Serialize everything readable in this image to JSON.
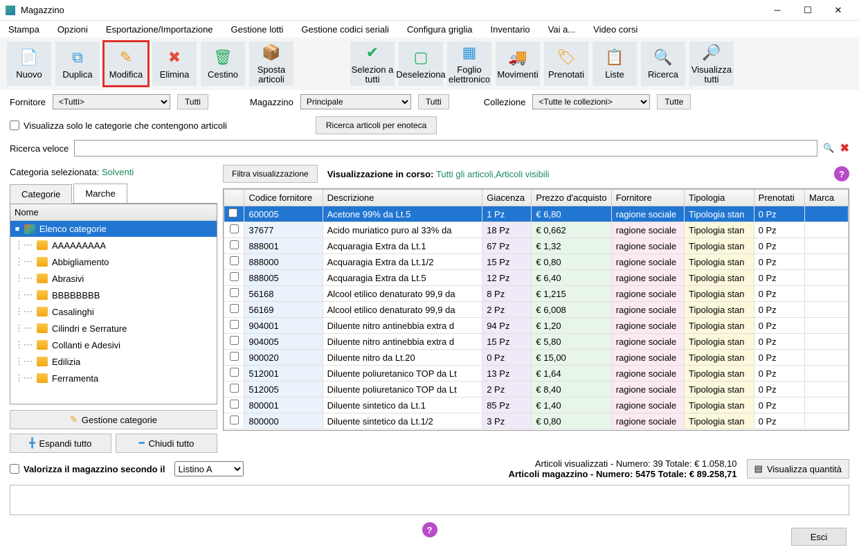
{
  "window": {
    "title": "Magazzino"
  },
  "menu": [
    "Stampa",
    "Opzioni",
    "Esportazione/Importazione",
    "Gestione lotti",
    "Gestione codici seriali",
    "Configura griglia",
    "Inventario",
    "Vai a...",
    "Video corsi"
  ],
  "toolbar": [
    {
      "id": "nuovo",
      "label": "Nuovo",
      "icon": "📄",
      "cls": "ic-orange"
    },
    {
      "id": "duplica",
      "label": "Duplica",
      "icon": "⧉",
      "cls": "ic-blue"
    },
    {
      "id": "modifica",
      "label": "Modifica",
      "icon": "✎",
      "cls": "ic-orange",
      "hl": true
    },
    {
      "id": "elimina",
      "label": "Elimina",
      "icon": "✖",
      "cls": "ic-red"
    },
    {
      "id": "cestino",
      "label": "Cestino",
      "icon": "🗑",
      "cls": "ic-green"
    },
    {
      "id": "sposta",
      "label": "Sposta articoli",
      "icon": "📦",
      "cls": "ic-orange"
    },
    {
      "id": "gap",
      "label": "",
      "icon": "",
      "gap": true
    },
    {
      "id": "seltutti",
      "label": "Selezion a tutti",
      "icon": "✔",
      "cls": "ic-green"
    },
    {
      "id": "desel",
      "label": "Deseleziona",
      "icon": "▢",
      "cls": "ic-green"
    },
    {
      "id": "foglio",
      "label": "Foglio elettronico",
      "icon": "▦",
      "cls": "ic-blue"
    },
    {
      "id": "movimenti",
      "label": "Movimenti",
      "icon": "🚚",
      "cls": "ic-blue"
    },
    {
      "id": "prenotati",
      "label": "Prenotati",
      "icon": "🏷",
      "cls": "ic-orange"
    },
    {
      "id": "liste",
      "label": "Liste",
      "icon": "📋",
      "cls": "ic-orange"
    },
    {
      "id": "ricerca",
      "label": "Ricerca",
      "icon": "🔍",
      "cls": "ic-blue"
    },
    {
      "id": "vistutti",
      "label": "Visualizza tutti",
      "icon": "🔎",
      "cls": "ic-blue"
    }
  ],
  "filters": {
    "fornitore_label": "Fornitore",
    "fornitore_value": "<Tutti>",
    "tutti": "Tutti",
    "magazzino_label": "Magazzino",
    "magazzino_value": "Principale",
    "collezione_label": "Collezione",
    "collezione_value": "<Tutte le collezioni>",
    "tutte": "Tutte",
    "showonly": "Visualizza solo le categorie che contengono articoli",
    "ricerca_enoteca": "Ricerca articoli per enoteca",
    "ricerca_veloce": "Ricerca veloce"
  },
  "left": {
    "header_prefix": "Categoria selezionata: ",
    "header_value": "Solventi",
    "tab_cat": "Categorie",
    "tab_marche": "Marche",
    "tree_header": "Nome",
    "root": "Elenco categorie",
    "items": [
      "AAAAAAAAA",
      "Abbigliamento",
      "Abrasivi",
      "BBBBBBBB",
      "Casalinghi",
      "Cilindri e Serrature",
      "Collanti e Adesivi",
      "Edilizia",
      "Ferramenta"
    ],
    "btn_gestione": "Gestione categorie",
    "btn_espandi": "Espandi tutto",
    "btn_chiudi": "Chiudi tutto"
  },
  "grid": {
    "filter_btn": "Filtra visualizzazione",
    "vis_prefix": "Visualizzazione in corso: ",
    "vis_value": "Tutti gli articoli,Articoli visibili",
    "headers": [
      "",
      "Codice fornitore",
      "Descrizione",
      "Giacenza",
      "Prezzo d'acquisto",
      "Fornitore",
      "Tipologia",
      "Prenotati",
      "Marca"
    ],
    "rows": [
      {
        "code": "600005",
        "desc": "Acetone 99% da Lt.5",
        "giac": "1 Pz",
        "prezzo": "€ 6,80",
        "forn": "ragione sociale",
        "tipo": "Tipologia stan",
        "pren": "0 Pz",
        "marca": "",
        "sel": true
      },
      {
        "code": "37677",
        "desc": "Acido muriatico puro al 33% da",
        "giac": "18 Pz",
        "prezzo": "€ 0,662",
        "forn": "ragione sociale",
        "tipo": "Tipologia stan",
        "pren": "0 Pz",
        "marca": ""
      },
      {
        "code": "888001",
        "desc": "Acquaragia Extra da Lt.1",
        "giac": "67 Pz",
        "prezzo": "€ 1,32",
        "forn": "ragione sociale",
        "tipo": "Tipologia stan",
        "pren": "0 Pz",
        "marca": ""
      },
      {
        "code": "888000",
        "desc": "Acquaragia Extra da Lt.1/2",
        "giac": "15 Pz",
        "prezzo": "€ 0,80",
        "forn": "ragione sociale",
        "tipo": "Tipologia stan",
        "pren": "0 Pz",
        "marca": ""
      },
      {
        "code": "888005",
        "desc": "Acquaragia Extra da Lt.5",
        "giac": "12 Pz",
        "prezzo": "€ 6,40",
        "forn": "ragione sociale",
        "tipo": "Tipologia stan",
        "pren": "0 Pz",
        "marca": ""
      },
      {
        "code": "56168",
        "desc": "Alcool etilico denaturato 99,9 da",
        "giac": "8 Pz",
        "prezzo": "€ 1,215",
        "forn": "ragione sociale",
        "tipo": "Tipologia stan",
        "pren": "0 Pz",
        "marca": ""
      },
      {
        "code": "56169",
        "desc": "Alcool etilico denaturato 99,9 da",
        "giac": "2 Pz",
        "prezzo": "€ 6,008",
        "forn": "ragione sociale",
        "tipo": "Tipologia stan",
        "pren": "0 Pz",
        "marca": ""
      },
      {
        "code": "904001",
        "desc": "Diluente nitro antinebbia extra d",
        "giac": "94 Pz",
        "prezzo": "€ 1,20",
        "forn": "ragione sociale",
        "tipo": "Tipologia stan",
        "pren": "0 Pz",
        "marca": ""
      },
      {
        "code": "904005",
        "desc": "Diluente nitro antinebbia extra d",
        "giac": "15 Pz",
        "prezzo": "€ 5,80",
        "forn": "ragione sociale",
        "tipo": "Tipologia stan",
        "pren": "0 Pz",
        "marca": ""
      },
      {
        "code": "900020",
        "desc": "Diluente nitro da Lt.20",
        "giac": "0 Pz",
        "prezzo": "€ 15,00",
        "forn": "ragione sociale",
        "tipo": "Tipologia stan",
        "pren": "0 Pz",
        "marca": ""
      },
      {
        "code": "512001",
        "desc": "Diluente poliuretanico TOP da Lt",
        "giac": "13 Pz",
        "prezzo": "€ 1,64",
        "forn": "ragione sociale",
        "tipo": "Tipologia stan",
        "pren": "0 Pz",
        "marca": ""
      },
      {
        "code": "512005",
        "desc": "Diluente poliuretanico TOP da Lt",
        "giac": "2 Pz",
        "prezzo": "€ 8,40",
        "forn": "ragione sociale",
        "tipo": "Tipologia stan",
        "pren": "0 Pz",
        "marca": ""
      },
      {
        "code": "800001",
        "desc": "Diluente sintetico da Lt.1",
        "giac": "85 Pz",
        "prezzo": "€ 1,40",
        "forn": "ragione sociale",
        "tipo": "Tipologia stan",
        "pren": "0 Pz",
        "marca": ""
      },
      {
        "code": "800000",
        "desc": "Diluente sintetico da Lt.1/2",
        "giac": "3 Pz",
        "prezzo": "€ 0,80",
        "forn": "ragione sociale",
        "tipo": "Tipologia stan",
        "pren": "0 Pz",
        "marca": ""
      }
    ]
  },
  "footer": {
    "valorizza": "Valorizza il magazzino secondo il",
    "listino": "Listino A",
    "summary1": "Articoli visualizzati - Numero: 39 Totale: € 1.058,10",
    "summary2": "Articoli magazzino - Numero: 5475 Totale: € 89.258,71",
    "visq": "Visualizza quantità",
    "esci": "Esci"
  }
}
